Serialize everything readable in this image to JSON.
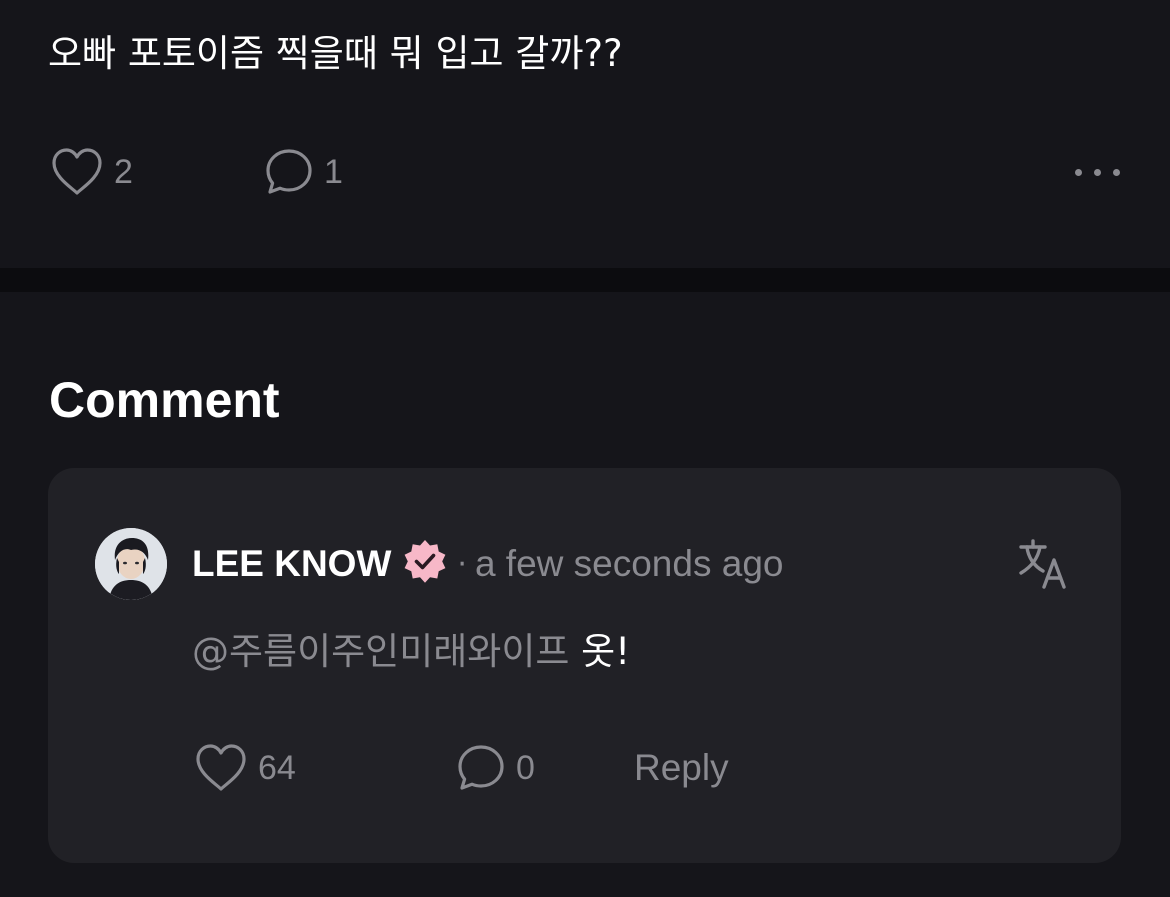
{
  "post": {
    "text": "오빠 포토이즘 찍을때 뭐 입고 갈까??",
    "like_count": "2",
    "comment_count": "1",
    "like_icon": "heart-icon",
    "comment_icon": "speech-bubble-icon",
    "more_icon": "more-horizontal-icon"
  },
  "comments_section": {
    "heading": "Comment",
    "items": [
      {
        "author": "LEE KNOW",
        "verified_icon": "verified-badge-icon",
        "separator": "·",
        "timestamp": "a few seconds ago",
        "translate_icon": "translate-icon",
        "mention": "@주름이주인미래와이프",
        "text": " 옷!",
        "like_count": "64",
        "reply_count": "0",
        "reply_label": "Reply"
      }
    ]
  },
  "colors": {
    "background": "#15151a",
    "divider": "#0c0c0f",
    "card": "#212126",
    "muted_text": "#8a8a90",
    "primary_text": "#ffffff",
    "verified_badge": "#f7b8c8"
  }
}
